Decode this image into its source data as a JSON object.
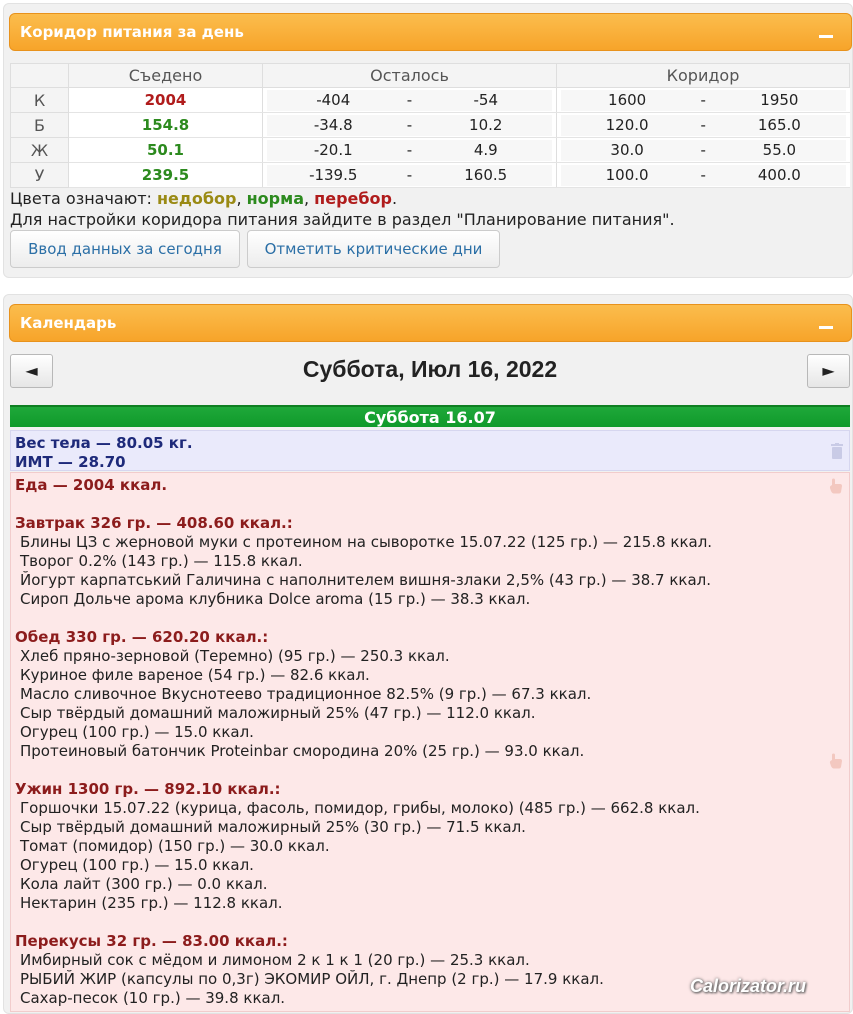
{
  "corridor_panel": {
    "title": "Коридор питания за день",
    "table": {
      "headers": [
        "Съедено",
        "Осталось",
        "Коридор"
      ],
      "dash": "-",
      "rows": [
        {
          "label": "К",
          "eaten": "2004",
          "eaten_color": "#b01c1c",
          "left_min": "-404",
          "left_max": "-54",
          "range_min": "1600",
          "range_max": "1950"
        },
        {
          "label": "Б",
          "eaten": "154.8",
          "eaten_color": "#2c8a1e",
          "left_min": "-34.8",
          "left_max": "10.2",
          "range_min": "120.0",
          "range_max": "165.0"
        },
        {
          "label": "Ж",
          "eaten": "50.1",
          "eaten_color": "#2c8a1e",
          "left_min": "-20.1",
          "left_max": "4.9",
          "range_min": "30.0",
          "range_max": "55.0"
        },
        {
          "label": "У",
          "eaten": "239.5",
          "eaten_color": "#2c8a1e",
          "left_min": "-139.5",
          "left_max": "160.5",
          "range_min": "100.0",
          "range_max": "400.0"
        }
      ]
    },
    "legend": {
      "prefix": "Цвета означают: ",
      "under": "недобор",
      "sep1": ", ",
      "norm": "норма",
      "sep2": ", ",
      "over": "перебор",
      "end": ".",
      "colors": {
        "under": "#9a8a14",
        "norm": "#2c8a1e",
        "over": "#b01c1c"
      }
    },
    "settings_note": "Для настройки коридора питания зайдите в раздел \"Планирование питания\".",
    "buttons": {
      "enter_today": "Ввод данных за сегодня",
      "critical_days": "Отметить критические дни"
    }
  },
  "calendar_panel": {
    "title": "Календарь",
    "prev": "◄",
    "next": "►",
    "date_title": "Суббота, Июл 16, 2022",
    "day_bar": "Суббота 16.07",
    "weight": {
      "line1": "Вес тела — 80.05 кг.",
      "line2": "ИМТ — 28.70"
    },
    "food_total": "Еда — 2004 ккал.",
    "meals": [
      {
        "header": "Завтрак 326 гр. — 408.60 ккал.:",
        "items": [
          "Блины ЦЗ с жерновой муки с протеином на сыворотке 15.07.22 (125 гр.) — 215.8 ккал.",
          "Творог 0.2% (143 гр.) — 115.8 ккал.",
          "Йогурт карпатський Галичина с наполнителем вишня-злаки 2,5% (43 гр.) — 38.7 ккал.",
          "Сироп Дольче арома клубника Dolce aroma (15 гр.) — 38.3 ккал."
        ]
      },
      {
        "header": "Обед 330 гр. — 620.20 ккал.:",
        "items": [
          "Хлеб пряно-зерновой (Теремно) (95 гр.) — 250.3 ккал.",
          "Куриное филе вареное (54 гр.) — 82.6 ккал.",
          "Масло сливочное Вкуснотеево традиционное 82.5% (9 гр.) — 67.3 ккал.",
          "Сыр твёрдый домашний маложирный 25% (47 гр.) — 112.0 ккал.",
          "Огурец (100 гр.) — 15.0 ккал.",
          "Протеиновый батончик Proteinbar смородина 20% (25 гр.) — 93.0 ккал."
        ]
      },
      {
        "header": "Ужин 1300 гр. — 892.10 ккал.:",
        "items": [
          "Горшочки 15.07.22 (курица, фасоль, помидор, грибы, молоко) (485 гр.) — 662.8 ккал.",
          "Сыр твёрдый домашний маложирный 25% (30 гр.) — 71.5 ккал.",
          "Томат (помидор) (150 гр.) — 30.0 ккал.",
          "Огурец (100 гр.) — 15.0 ккал.",
          "Кола лайт (300 гр.) — 0.0 ккал.",
          "Нектарин (235 гр.) — 112.8 ккал."
        ]
      },
      {
        "header": "Перекусы 32 гр. — 83.00 ккал.:",
        "items": [
          "Имбирный сок с мёдом и лимоном 2 к 1 к 1 (20 гр.) — 25.3 ккал.",
          "РЫБИЙ ЖИР (капсулы по 0,3г) ЭКОМИР ОЙЛ, г. Днепр (2 гр.) — 17.9 ккал.",
          "Сахар-песок (10 гр.) — 39.8 ккал."
        ]
      }
    ]
  },
  "watermark": "Calorizator.ru"
}
